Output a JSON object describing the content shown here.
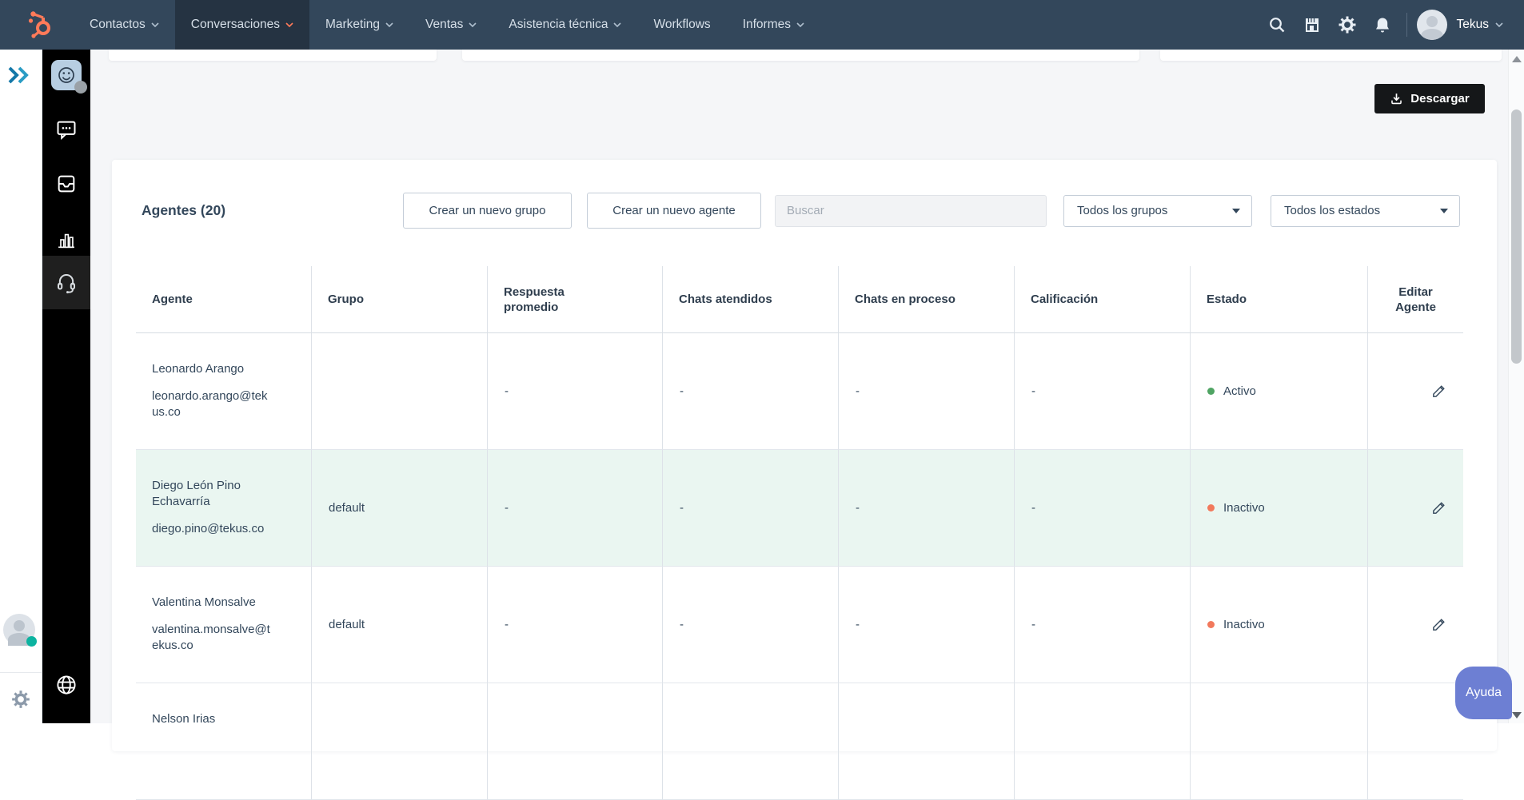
{
  "nav": {
    "items": [
      {
        "label": "Contactos"
      },
      {
        "label": "Conversaciones"
      },
      {
        "label": "Marketing"
      },
      {
        "label": "Ventas"
      },
      {
        "label": "Asistencia técnica"
      },
      {
        "label": "Workflows"
      },
      {
        "label": "Informes"
      }
    ],
    "account_name": "Tekus"
  },
  "toolbar": {
    "download_label": "Descargar"
  },
  "agents_section": {
    "title": "Agentes (20)",
    "create_group_label": "Crear un nuevo grupo",
    "create_agent_label": "Crear un nuevo agente",
    "search_placeholder": "Buscar",
    "group_filter_value": "Todos los grupos",
    "state_filter_value": "Todos los estados"
  },
  "table": {
    "headers": [
      "Agente",
      "Grupo",
      "Respuesta promedio",
      "Chats atendidos",
      "Chats en proceso",
      "Calificación",
      "Estado",
      "Editar Agente"
    ],
    "rows": [
      {
        "name": "Leonardo Arango",
        "email": "leonardo.arango@tekus.co",
        "group": "",
        "avg_response": "-",
        "chats_attended": "-",
        "chats_in_progress": "-",
        "rating": "-",
        "status": "Activo",
        "status_color": "#4fa463"
      },
      {
        "name": "Diego León Pino Echavarría",
        "email": "diego.pino@tekus.co",
        "group": "default",
        "avg_response": "-",
        "chats_attended": "-",
        "chats_in_progress": "-",
        "rating": "-",
        "status": "Inactivo",
        "status_color": "#f2795c"
      },
      {
        "name": "Valentina Monsalve",
        "email": "valentina.monsalve@tekus.co",
        "group": "default",
        "avg_response": "-",
        "chats_attended": "-",
        "chats_in_progress": "-",
        "rating": "-",
        "status": "Inactivo",
        "status_color": "#f2795c"
      },
      {
        "name": "Nelson Irias",
        "email": "",
        "group": "",
        "avg_response": "",
        "chats_attended": "",
        "chats_in_progress": "",
        "rating": "",
        "status": "",
        "status_color": ""
      }
    ]
  },
  "help_button": {
    "label": "Ayuda"
  },
  "colors": {
    "brand_orange": "#ff7a59",
    "nav_bg": "#33475b",
    "nav_active_bg": "#253342",
    "status_active_green": "#4fa463",
    "status_inactive_orange": "#f2795c",
    "row_highlight_mint": "#eaf6f1",
    "help_button_purple": "#6d7fd3",
    "sidebar_black": "#000000"
  }
}
